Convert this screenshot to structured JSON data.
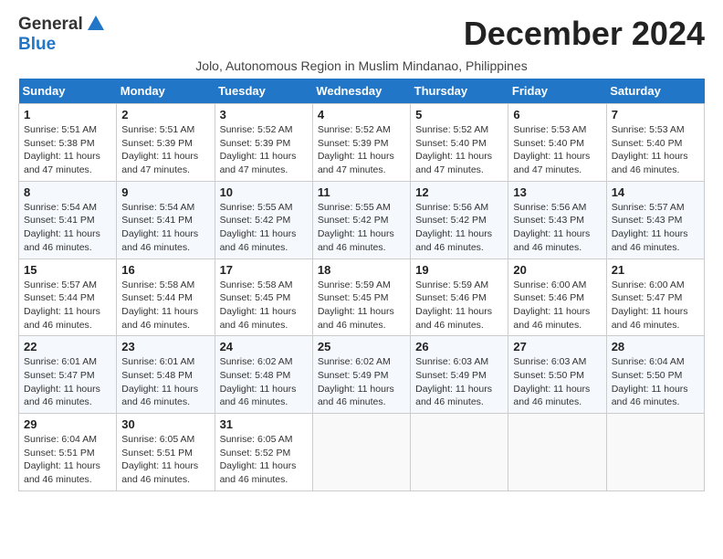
{
  "header": {
    "logo_general": "General",
    "logo_blue": "Blue",
    "month_year": "December 2024",
    "location": "Jolo, Autonomous Region in Muslim Mindanao, Philippines"
  },
  "columns": [
    "Sunday",
    "Monday",
    "Tuesday",
    "Wednesday",
    "Thursday",
    "Friday",
    "Saturday"
  ],
  "weeks": [
    [
      {
        "day": "1",
        "sunrise": "5:51 AM",
        "sunset": "5:38 PM",
        "daylight": "11 hours and 47 minutes."
      },
      {
        "day": "2",
        "sunrise": "5:51 AM",
        "sunset": "5:39 PM",
        "daylight": "11 hours and 47 minutes."
      },
      {
        "day": "3",
        "sunrise": "5:52 AM",
        "sunset": "5:39 PM",
        "daylight": "11 hours and 47 minutes."
      },
      {
        "day": "4",
        "sunrise": "5:52 AM",
        "sunset": "5:39 PM",
        "daylight": "11 hours and 47 minutes."
      },
      {
        "day": "5",
        "sunrise": "5:52 AM",
        "sunset": "5:40 PM",
        "daylight": "11 hours and 47 minutes."
      },
      {
        "day": "6",
        "sunrise": "5:53 AM",
        "sunset": "5:40 PM",
        "daylight": "11 hours and 47 minutes."
      },
      {
        "day": "7",
        "sunrise": "5:53 AM",
        "sunset": "5:40 PM",
        "daylight": "11 hours and 46 minutes."
      }
    ],
    [
      {
        "day": "8",
        "sunrise": "5:54 AM",
        "sunset": "5:41 PM",
        "daylight": "11 hours and 46 minutes."
      },
      {
        "day": "9",
        "sunrise": "5:54 AM",
        "sunset": "5:41 PM",
        "daylight": "11 hours and 46 minutes."
      },
      {
        "day": "10",
        "sunrise": "5:55 AM",
        "sunset": "5:42 PM",
        "daylight": "11 hours and 46 minutes."
      },
      {
        "day": "11",
        "sunrise": "5:55 AM",
        "sunset": "5:42 PM",
        "daylight": "11 hours and 46 minutes."
      },
      {
        "day": "12",
        "sunrise": "5:56 AM",
        "sunset": "5:42 PM",
        "daylight": "11 hours and 46 minutes."
      },
      {
        "day": "13",
        "sunrise": "5:56 AM",
        "sunset": "5:43 PM",
        "daylight": "11 hours and 46 minutes."
      },
      {
        "day": "14",
        "sunrise": "5:57 AM",
        "sunset": "5:43 PM",
        "daylight": "11 hours and 46 minutes."
      }
    ],
    [
      {
        "day": "15",
        "sunrise": "5:57 AM",
        "sunset": "5:44 PM",
        "daylight": "11 hours and 46 minutes."
      },
      {
        "day": "16",
        "sunrise": "5:58 AM",
        "sunset": "5:44 PM",
        "daylight": "11 hours and 46 minutes."
      },
      {
        "day": "17",
        "sunrise": "5:58 AM",
        "sunset": "5:45 PM",
        "daylight": "11 hours and 46 minutes."
      },
      {
        "day": "18",
        "sunrise": "5:59 AM",
        "sunset": "5:45 PM",
        "daylight": "11 hours and 46 minutes."
      },
      {
        "day": "19",
        "sunrise": "5:59 AM",
        "sunset": "5:46 PM",
        "daylight": "11 hours and 46 minutes."
      },
      {
        "day": "20",
        "sunrise": "6:00 AM",
        "sunset": "5:46 PM",
        "daylight": "11 hours and 46 minutes."
      },
      {
        "day": "21",
        "sunrise": "6:00 AM",
        "sunset": "5:47 PM",
        "daylight": "11 hours and 46 minutes."
      }
    ],
    [
      {
        "day": "22",
        "sunrise": "6:01 AM",
        "sunset": "5:47 PM",
        "daylight": "11 hours and 46 minutes."
      },
      {
        "day": "23",
        "sunrise": "6:01 AM",
        "sunset": "5:48 PM",
        "daylight": "11 hours and 46 minutes."
      },
      {
        "day": "24",
        "sunrise": "6:02 AM",
        "sunset": "5:48 PM",
        "daylight": "11 hours and 46 minutes."
      },
      {
        "day": "25",
        "sunrise": "6:02 AM",
        "sunset": "5:49 PM",
        "daylight": "11 hours and 46 minutes."
      },
      {
        "day": "26",
        "sunrise": "6:03 AM",
        "sunset": "5:49 PM",
        "daylight": "11 hours and 46 minutes."
      },
      {
        "day": "27",
        "sunrise": "6:03 AM",
        "sunset": "5:50 PM",
        "daylight": "11 hours and 46 minutes."
      },
      {
        "day": "28",
        "sunrise": "6:04 AM",
        "sunset": "5:50 PM",
        "daylight": "11 hours and 46 minutes."
      }
    ],
    [
      {
        "day": "29",
        "sunrise": "6:04 AM",
        "sunset": "5:51 PM",
        "daylight": "11 hours and 46 minutes."
      },
      {
        "day": "30",
        "sunrise": "6:05 AM",
        "sunset": "5:51 PM",
        "daylight": "11 hours and 46 minutes."
      },
      {
        "day": "31",
        "sunrise": "6:05 AM",
        "sunset": "5:52 PM",
        "daylight": "11 hours and 46 minutes."
      },
      null,
      null,
      null,
      null
    ]
  ],
  "labels": {
    "sunrise": "Sunrise: ",
    "sunset": "Sunset: ",
    "daylight": "Daylight: "
  }
}
